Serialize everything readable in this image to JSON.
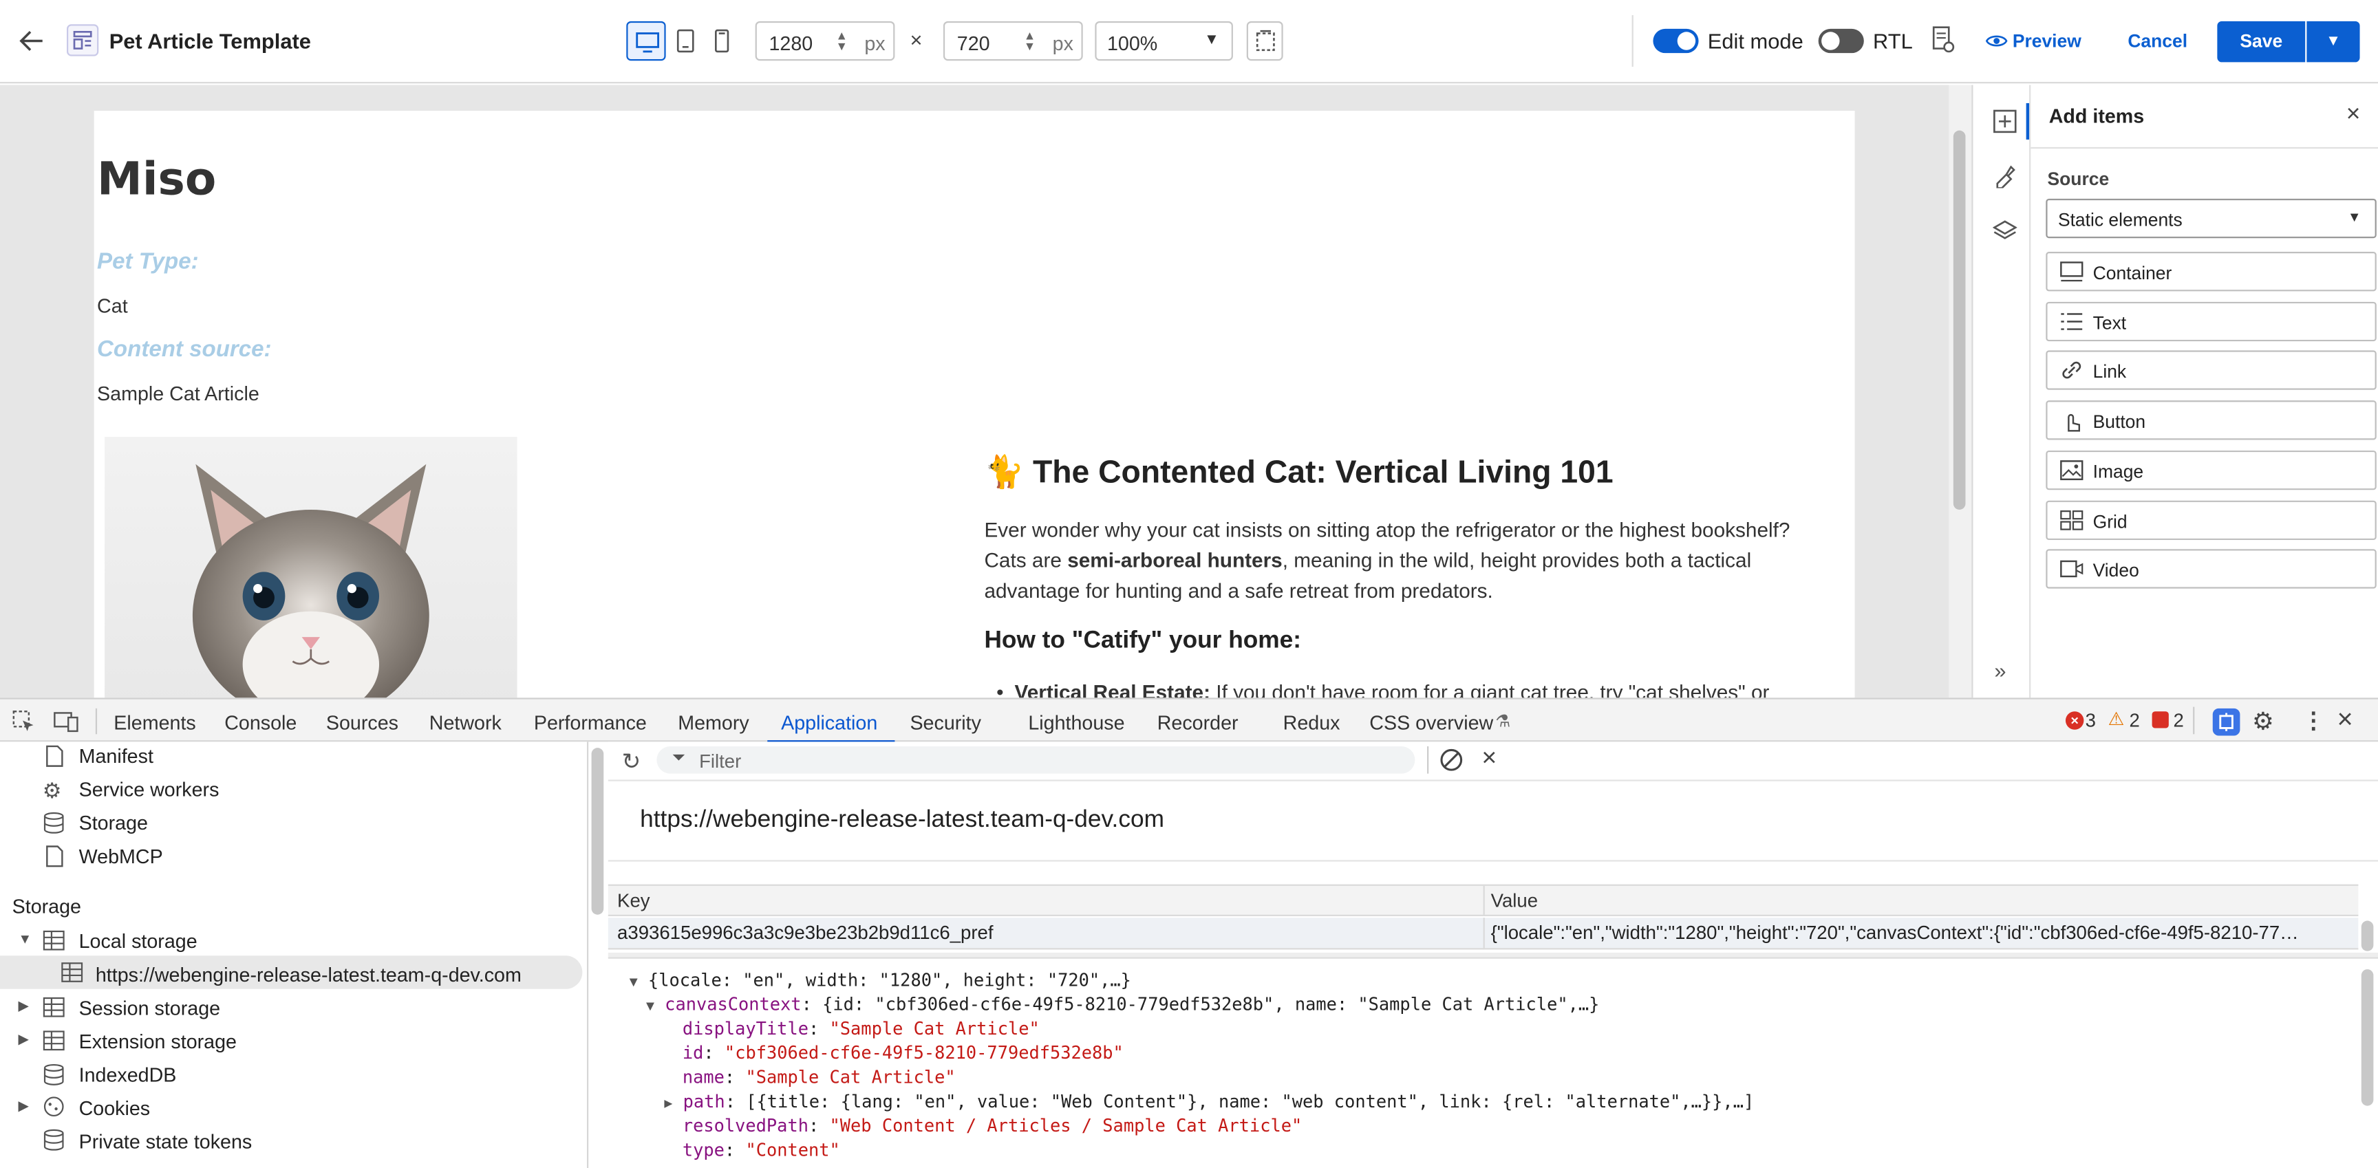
{
  "appbar": {
    "title": "Pet Article Template",
    "width_value": "1280",
    "height_value": "720",
    "unit": "px",
    "times": "×",
    "zoom": "100%",
    "edit_mode_label": "Edit mode",
    "edit_mode_on": true,
    "rtl_label": "RTL",
    "rtl_on": false,
    "preview_label": "Preview",
    "cancel_label": "Cancel",
    "save_label": "Save"
  },
  "article": {
    "name": "Miso",
    "pet_type_label": "Pet Type:",
    "pet_type_value": "Cat",
    "content_source_label": "Content source:",
    "content_source_value": "Sample Cat Article",
    "heading_emoji": "🐈",
    "heading": "The Contented Cat: Vertical Living 101",
    "para1_line1": "Ever wonder why your cat insists on sitting atop the refrigerator or the highest bookshelf?",
    "para1_line2_pre": "Cats are ",
    "para1_line2_bold": "semi-arboreal hunters",
    "para1_line2_post": ", meaning in the wild, height provides both a tactical",
    "para1_line3": "advantage for hunting and a safe retreat from predators.",
    "subheading": "How to \"Catify\" your home:",
    "bullet_bold": "Vertical Real Estate:",
    "bullet_text": " If you don't have room for a giant cat tree, try \"cat shelves\" or"
  },
  "add_items": {
    "title": "Add items",
    "source_label": "Source",
    "source_value": "Static elements",
    "items": [
      {
        "label": "Container",
        "icon": "container-icon"
      },
      {
        "label": "Text",
        "icon": "text-icon"
      },
      {
        "label": "Link",
        "icon": "link-icon"
      },
      {
        "label": "Button",
        "icon": "button-pointer-icon"
      },
      {
        "label": "Image",
        "icon": "image-icon"
      },
      {
        "label": "Grid",
        "icon": "grid-icon"
      },
      {
        "label": "Video",
        "icon": "video-icon"
      }
    ]
  },
  "devtools": {
    "tabs": [
      "Elements",
      "Console",
      "Sources",
      "Network",
      "Performance",
      "Memory",
      "Application",
      "Security",
      "Lighthouse",
      "Recorder",
      "Redux",
      "CSS overview"
    ],
    "active_tab": "Application",
    "errors": "3",
    "warnings": "2",
    "issues": "2",
    "sidebar": {
      "items": [
        "Manifest",
        "Service workers",
        "Storage",
        "WebMCP"
      ],
      "storage_heading": "Storage",
      "local_storage": "Local storage",
      "local_storage_origin": "https://webengine-release-latest.team-q-dev.com",
      "session_storage": "Session storage",
      "extension_storage": "Extension storage",
      "indexeddb": "IndexedDB",
      "cookies": "Cookies",
      "private_state_tokens": "Private state tokens"
    },
    "filter_placeholder": "Filter",
    "origin": "https://webengine-release-latest.team-q-dev.com",
    "table": {
      "key_header": "Key",
      "value_header": "Value",
      "row_key": "a393615e996c3a3c9e3be23b2b9d11c6_pref",
      "row_value": "{\"locale\":\"en\",\"width\":\"1280\",\"height\":\"720\",\"canvasContext\":{\"id\":\"cbf306ed-cf6e-49f5-8210-77…"
    },
    "preview": {
      "root": "{locale: \"en\", width: \"1280\", height: \"720\",…}",
      "canvas_key": "canvasContext",
      "canvas_summary": "{id: \"cbf306ed-cf6e-49f5-8210-779edf532e8b\", name: \"Sample Cat Article\",…}",
      "displayTitle_key": "displayTitle",
      "displayTitle_val": "\"Sample Cat Article\"",
      "id_key": "id",
      "id_val": "\"cbf306ed-cf6e-49f5-8210-779edf532e8b\"",
      "name_key": "name",
      "name_val": "\"Sample Cat Article\"",
      "path_key": "path",
      "path_val": "[{title: {lang: \"en\", value: \"Web Content\"}, name: \"web content\", link: {rel: \"alternate\",…}},…]",
      "resolvedPath_key": "resolvedPath",
      "resolvedPath_val": "\"Web Content / Articles / Sample Cat Article\"",
      "type_key": "type",
      "type_val": "\"Content\""
    }
  },
  "colors": {
    "accent": "#0b5fd1",
    "devtools_active": "#0b57d0",
    "label_blue": "#a9cde6",
    "error": "#d93025",
    "warning": "#e37400"
  }
}
